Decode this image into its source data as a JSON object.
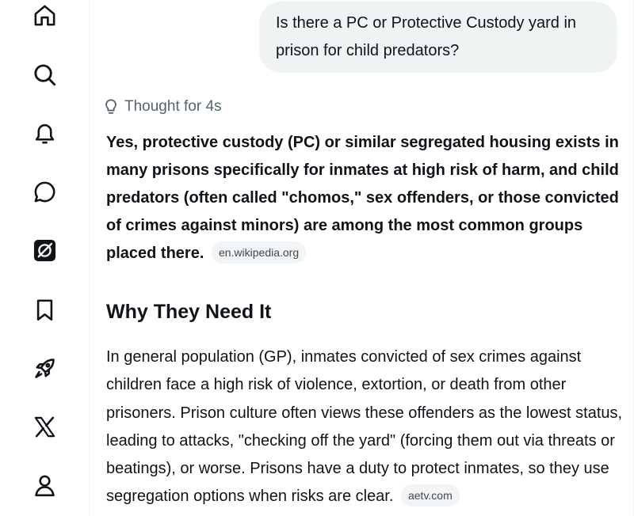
{
  "sidebar": {
    "items": [
      {
        "icon": "home-icon"
      },
      {
        "icon": "search-icon"
      },
      {
        "icon": "bell-icon"
      },
      {
        "icon": "message-icon"
      },
      {
        "icon": "grok-icon"
      },
      {
        "icon": "bookmark-icon"
      },
      {
        "icon": "rocket-icon"
      },
      {
        "icon": "x-logo-icon"
      },
      {
        "icon": "profile-icon"
      }
    ]
  },
  "chat": {
    "user_message": "Is there a PC or Protective Custody yard in prison for child predators?",
    "thought_label": "Thought for 4s",
    "answer_bold": "Yes, protective custody (PC) or similar segregated housing exists in many prisons specifically for inmates at high risk of harm, and child predators (often called \"chomos,\" sex offenders, or those convicted of crimes against minors) are among the most common groups placed there.",
    "answer_source": "en.wikipedia.org",
    "section_heading": "Why They Need It",
    "section_body": "In general population (GP), inmates convicted of sex crimes against children face a high risk of violence, extortion, or death from other prisoners. Prison culture often views these offenders as the lowest status, leading to attacks, \"checking off the yard\" (forcing them out via threats or beatings), or worse. Prisons have a duty to protect inmates, so they use segregation options when risks are clear.",
    "section_source": "aetv.com"
  },
  "colors": {
    "text": "#0f1419",
    "muted": "#536471",
    "bubble": "#eff3f4",
    "chip": "#f2f4f5"
  }
}
